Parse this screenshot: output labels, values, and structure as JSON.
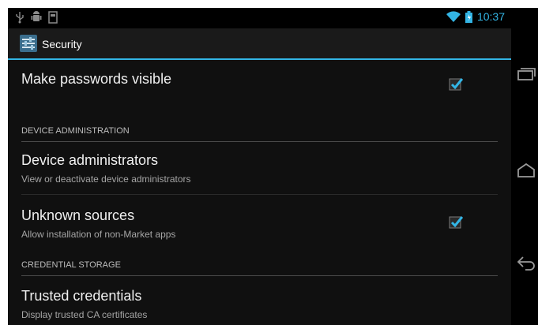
{
  "status_bar": {
    "time": "10:37",
    "left_icons": [
      "usb-icon",
      "android-debug-icon",
      "sd-card-icon"
    ],
    "right_icons": [
      "wifi-icon",
      "battery-icon"
    ]
  },
  "action_bar": {
    "title": "Security",
    "icon": "settings-app-icon",
    "accent_color": "#33b5e5"
  },
  "preferences": [
    {
      "id": "make-passwords-visible",
      "title": "Make passwords visible",
      "checked": true
    },
    {
      "id": "section-device-administration",
      "header": "DEVICE ADMINISTRATION"
    },
    {
      "id": "device-administrators",
      "title": "Device administrators",
      "summary": "View or deactivate device administrators"
    },
    {
      "id": "unknown-sources",
      "title": "Unknown sources",
      "summary": "Allow installation of non-Market apps",
      "checked": true
    },
    {
      "id": "section-credential-storage",
      "header": "CREDENTIAL STORAGE"
    },
    {
      "id": "trusted-credentials",
      "title": "Trusted credentials",
      "summary": "Display trusted CA certificates"
    }
  ],
  "nav_bar": {
    "buttons": [
      "recent-apps-icon",
      "home-icon",
      "back-icon"
    ]
  }
}
